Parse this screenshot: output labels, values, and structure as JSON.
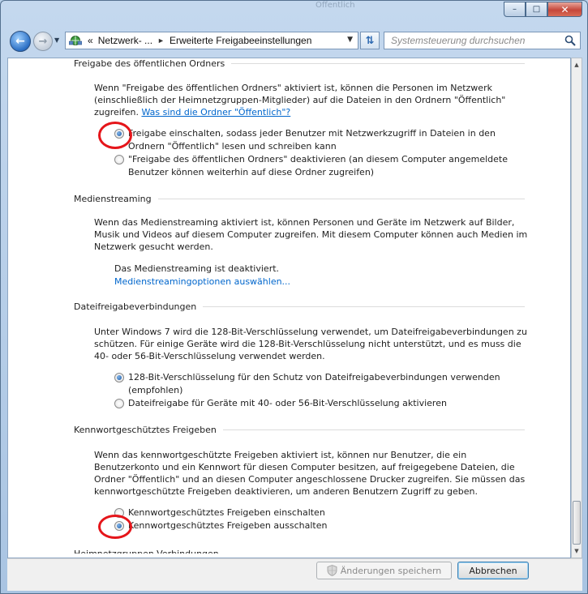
{
  "window": {
    "blurred_title": "Öffentlich",
    "buttons": {
      "minimize": "–",
      "maximize": "□",
      "close": "✕"
    }
  },
  "nav": {
    "address_prefix": "«",
    "breadcrumb": [
      "Netzwerk- ...",
      "Erweiterte Freigabeeinstellungen"
    ],
    "search_placeholder": "Systemsteuerung durchsuchen"
  },
  "sections": {
    "public": {
      "header": "Freigabe des öffentlichen Ordners",
      "description": "Wenn \"Freigabe des öffentlichen Ordners\" aktiviert ist, können die Personen im Netzwerk (einschließlich der Heimnetzgruppen-Mitglieder) auf die Dateien in den Ordnern \"Öffentlich\" zugreifen.",
      "link": "Was sind die Ordner \"Öffentlich\"?",
      "options": [
        {
          "label": "Freigabe einschalten, sodass jeder Benutzer mit Netzwerkzugriff in Dateien in den Ordnern \"Öffentlich\" lesen und schreiben kann",
          "checked": true
        },
        {
          "label": "\"Freigabe des öffentlichen Ordners\" deaktivieren (an diesem Computer angemeldete Benutzer können weiterhin auf diese Ordner zugreifen)",
          "checked": false
        }
      ]
    },
    "media": {
      "header": "Medienstreaming",
      "description": "Wenn das Medienstreaming aktiviert ist, können Personen und Geräte im Netzwerk auf Bilder, Musik und Videos auf diesem Computer zugreifen. Mit diesem Computer können auch Medien im Netzwerk gesucht werden.",
      "status": "Das Medienstreaming ist deaktiviert.",
      "link": "Medienstreamingoptionen auswählen..."
    },
    "connections": {
      "header": "Dateifreigabeverbindungen",
      "description": "Unter Windows 7 wird die 128-Bit-Verschlüsselung verwendet, um Dateifreigabeverbindungen zu schützen. Für einige Geräte wird die 128-Bit-Verschlüsselung nicht unterstützt, und es muss die 40- oder 56-Bit-Verschlüsselung verwendet werden.",
      "options": [
        {
          "label": "128-Bit-Verschlüsselung für den Schutz von Dateifreigabeverbindungen verwenden (empfohlen)",
          "checked": true
        },
        {
          "label": "Dateifreigabe für Geräte mit 40- oder 56-Bit-Verschlüsselung aktivieren",
          "checked": false
        }
      ]
    },
    "password": {
      "header": "Kennwortgeschütztes Freigeben",
      "description": "Wenn das kennwortgeschützte Freigeben aktiviert ist, können nur Benutzer, die ein Benutzerkonto und ein Kennwort für diesen Computer besitzen, auf freigegebene Dateien, die Ordner \"Öffentlich\" und an diesen Computer angeschlossene Drucker zugreifen. Sie müssen das kennwortgeschützte Freigeben deaktivieren, um anderen Benutzern Zugriff zu geben.",
      "options": [
        {
          "label": "Kennwortgeschütztes Freigeben einschalten",
          "checked": false
        },
        {
          "label": "Kennwortgeschütztes Freigeben ausschalten",
          "checked": true
        }
      ]
    },
    "cut_off_header": "Heimnetzgruppen-Verbindungen"
  },
  "footer": {
    "save_label": "Änderungen speichern",
    "cancel_label": "Abbrechen"
  },
  "colors": {
    "link": "#0066cc",
    "highlight_circle": "#e5151a"
  }
}
